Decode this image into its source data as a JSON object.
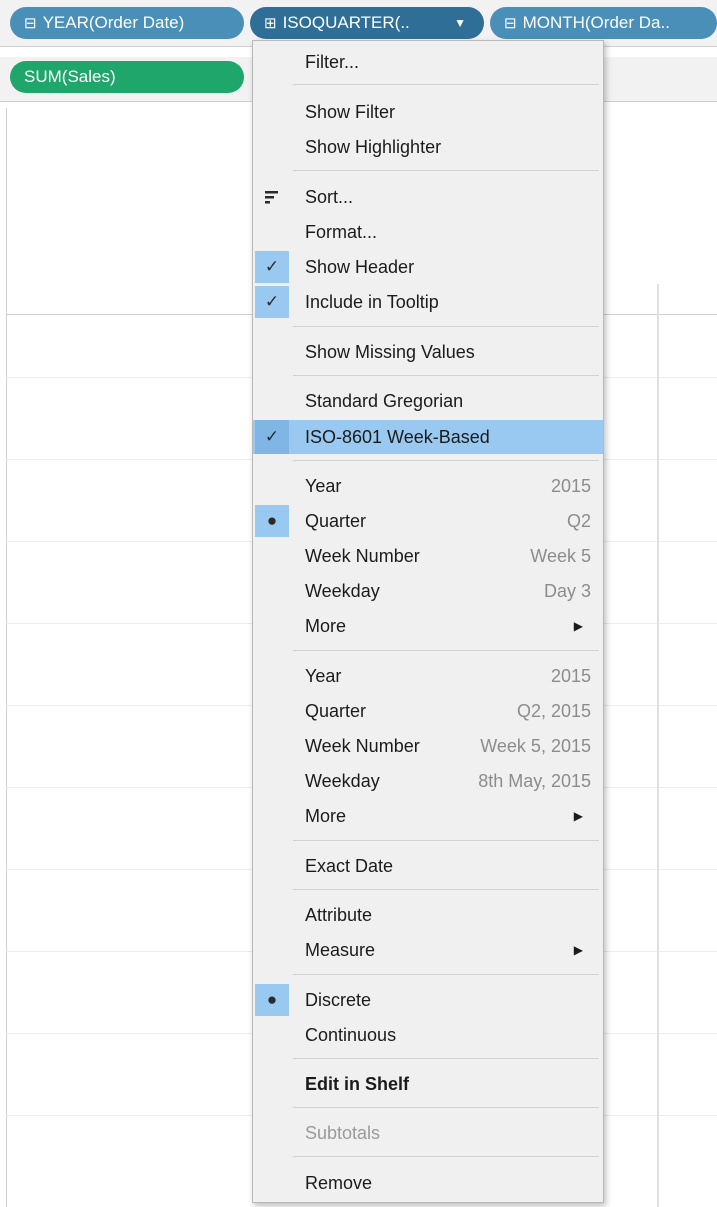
{
  "columns_shelf": {
    "pills": [
      {
        "icon": "⊟",
        "label": "YEAR(Order Date)"
      },
      {
        "icon": "⊞",
        "label": "ISOQUARTER(..",
        "caret": "▼"
      },
      {
        "icon": "⊟",
        "label": "MONTH(Order Da.."
      }
    ]
  },
  "rows_shelf": {
    "pills": [
      {
        "label": "SUM(Sales)"
      }
    ]
  },
  "context_menu": {
    "filter": "Filter...",
    "show_filter": "Show Filter",
    "show_highlighter": "Show Highlighter",
    "sort": "Sort...",
    "format": "Format...",
    "show_header": "Show Header",
    "include_in_tooltip": "Include in Tooltip",
    "show_missing_values": "Show Missing Values",
    "standard_gregorian": "Standard Gregorian",
    "iso_week_based": "ISO-8601 Week-Based",
    "date_parts": [
      {
        "label": "Year",
        "value": "2015"
      },
      {
        "label": "Quarter",
        "value": "Q2"
      },
      {
        "label": "Week Number",
        "value": "Week 5"
      },
      {
        "label": "Weekday",
        "value": "Day 3"
      },
      {
        "label": "More"
      }
    ],
    "date_values": [
      {
        "label": "Year",
        "value": "2015"
      },
      {
        "label": "Quarter",
        "value": "Q2, 2015"
      },
      {
        "label": "Week Number",
        "value": "Week 5, 2015"
      },
      {
        "label": "Weekday",
        "value": "8th May, 2015"
      },
      {
        "label": "More"
      }
    ],
    "exact_date": "Exact Date",
    "attribute": "Attribute",
    "measure": "Measure",
    "discrete": "Discrete",
    "continuous": "Continuous",
    "edit_in_shelf": "Edit in Shelf",
    "subtotals": "Subtotals",
    "remove": "Remove",
    "check_glyph": "✓",
    "bullet_glyph": "●",
    "submenu_arrow": "▶",
    "sort_icon": "sort-icon",
    "highlight_color": "#99c9f0"
  }
}
